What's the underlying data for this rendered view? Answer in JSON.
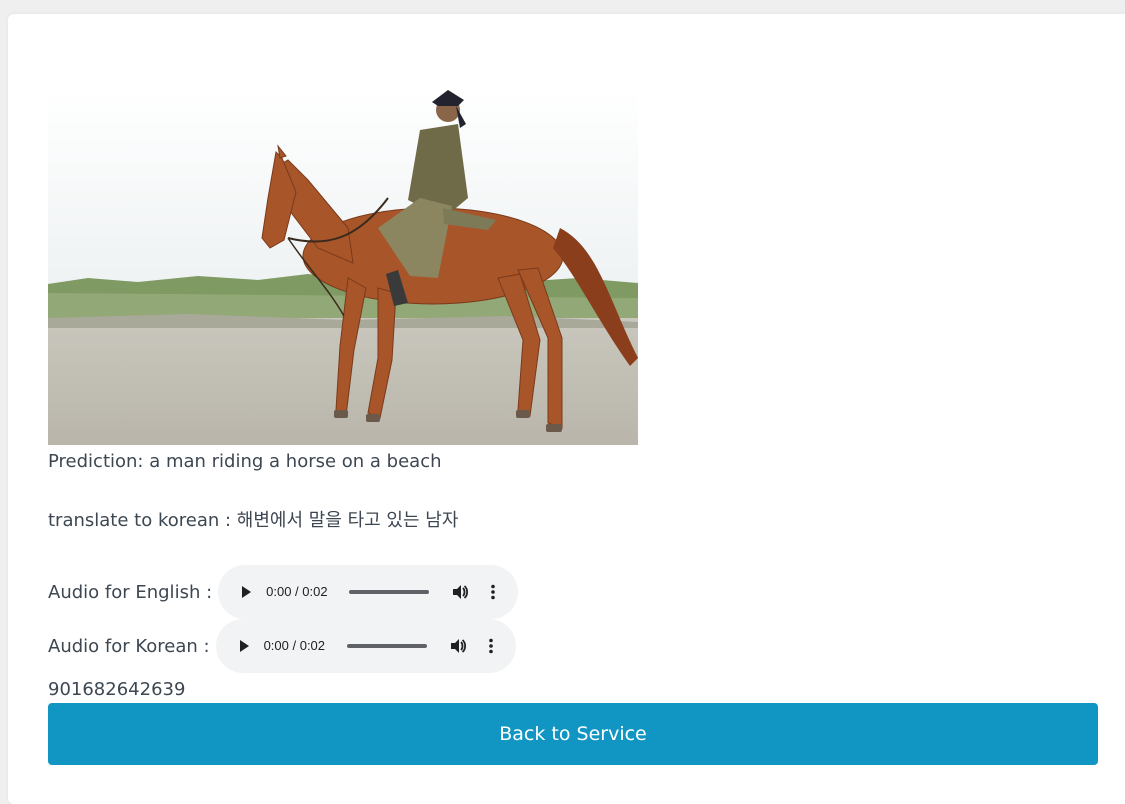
{
  "result": {
    "image_alt": "a man riding a horse on a beach",
    "prediction_text": "Prediction: a man riding a horse on a beach",
    "translation_text": "translate to korean : 해변에서 말을 타고 있는 남자",
    "id_number": "901682642639"
  },
  "audio_english": {
    "label": "Audio for English :",
    "time": "0:00 / 0:02"
  },
  "audio_korean": {
    "label": "Audio for Korean :",
    "time": "0:00 / 0:02"
  },
  "actions": {
    "back_label": "Back to Service"
  },
  "colors": {
    "button": "#1196c3",
    "player_bg": "#f1f3f4"
  },
  "icons": [
    "play-icon",
    "volume-icon",
    "more-options-icon"
  ]
}
